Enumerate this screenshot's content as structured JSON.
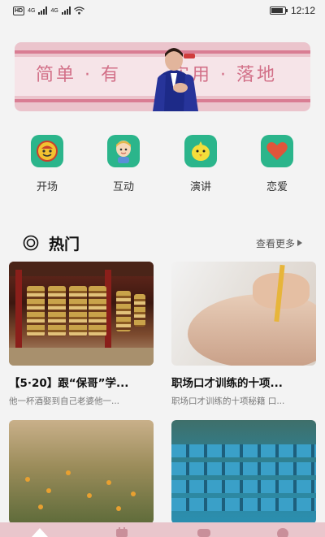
{
  "status_bar": {
    "hd_label": "HD",
    "signal_1_label": "4G",
    "signal_2_label": "4G",
    "battery_level": 0.85,
    "time": "12:12"
  },
  "banner": {
    "text": "简单·有____实用·落地",
    "text_left": "简单 · 有",
    "text_right": "实用 · 落地",
    "colors": {
      "background": "#ebc4cc",
      "text": "#d27088"
    }
  },
  "quick_nav": {
    "items": [
      {
        "label": "开场",
        "icon": "smiley-face-icon"
      },
      {
        "label": "互动",
        "icon": "boy-avatar-icon"
      },
      {
        "label": "演讲",
        "icon": "chick-icon"
      },
      {
        "label": "恋爱",
        "icon": "heart-icon"
      }
    ],
    "icon_color": "#2bb58b"
  },
  "hot_section": {
    "title": "热门",
    "more_label": "查看更多",
    "cards": [
      {
        "title": "【5·20】跟“保哥”学...",
        "desc": "他一杯酒娶到自己老婆他一...",
        "image": "prayer-wheels-image"
      },
      {
        "title": "职场口才训练的十项...",
        "desc": "职场口才训练的十项秘籍 口...",
        "image": "face-pencil-image"
      },
      {
        "title": "",
        "desc": "",
        "image": "flowers-image"
      },
      {
        "title": "",
        "desc": "",
        "image": "stadium-seats-image"
      }
    ]
  },
  "tab_bar": {
    "items": [
      {
        "icon": "home-icon",
        "active": true
      },
      {
        "icon": "category-icon",
        "active": false
      },
      {
        "icon": "message-icon",
        "active": false
      },
      {
        "icon": "profile-icon",
        "active": false
      }
    ],
    "background": "#e9c6cc"
  }
}
